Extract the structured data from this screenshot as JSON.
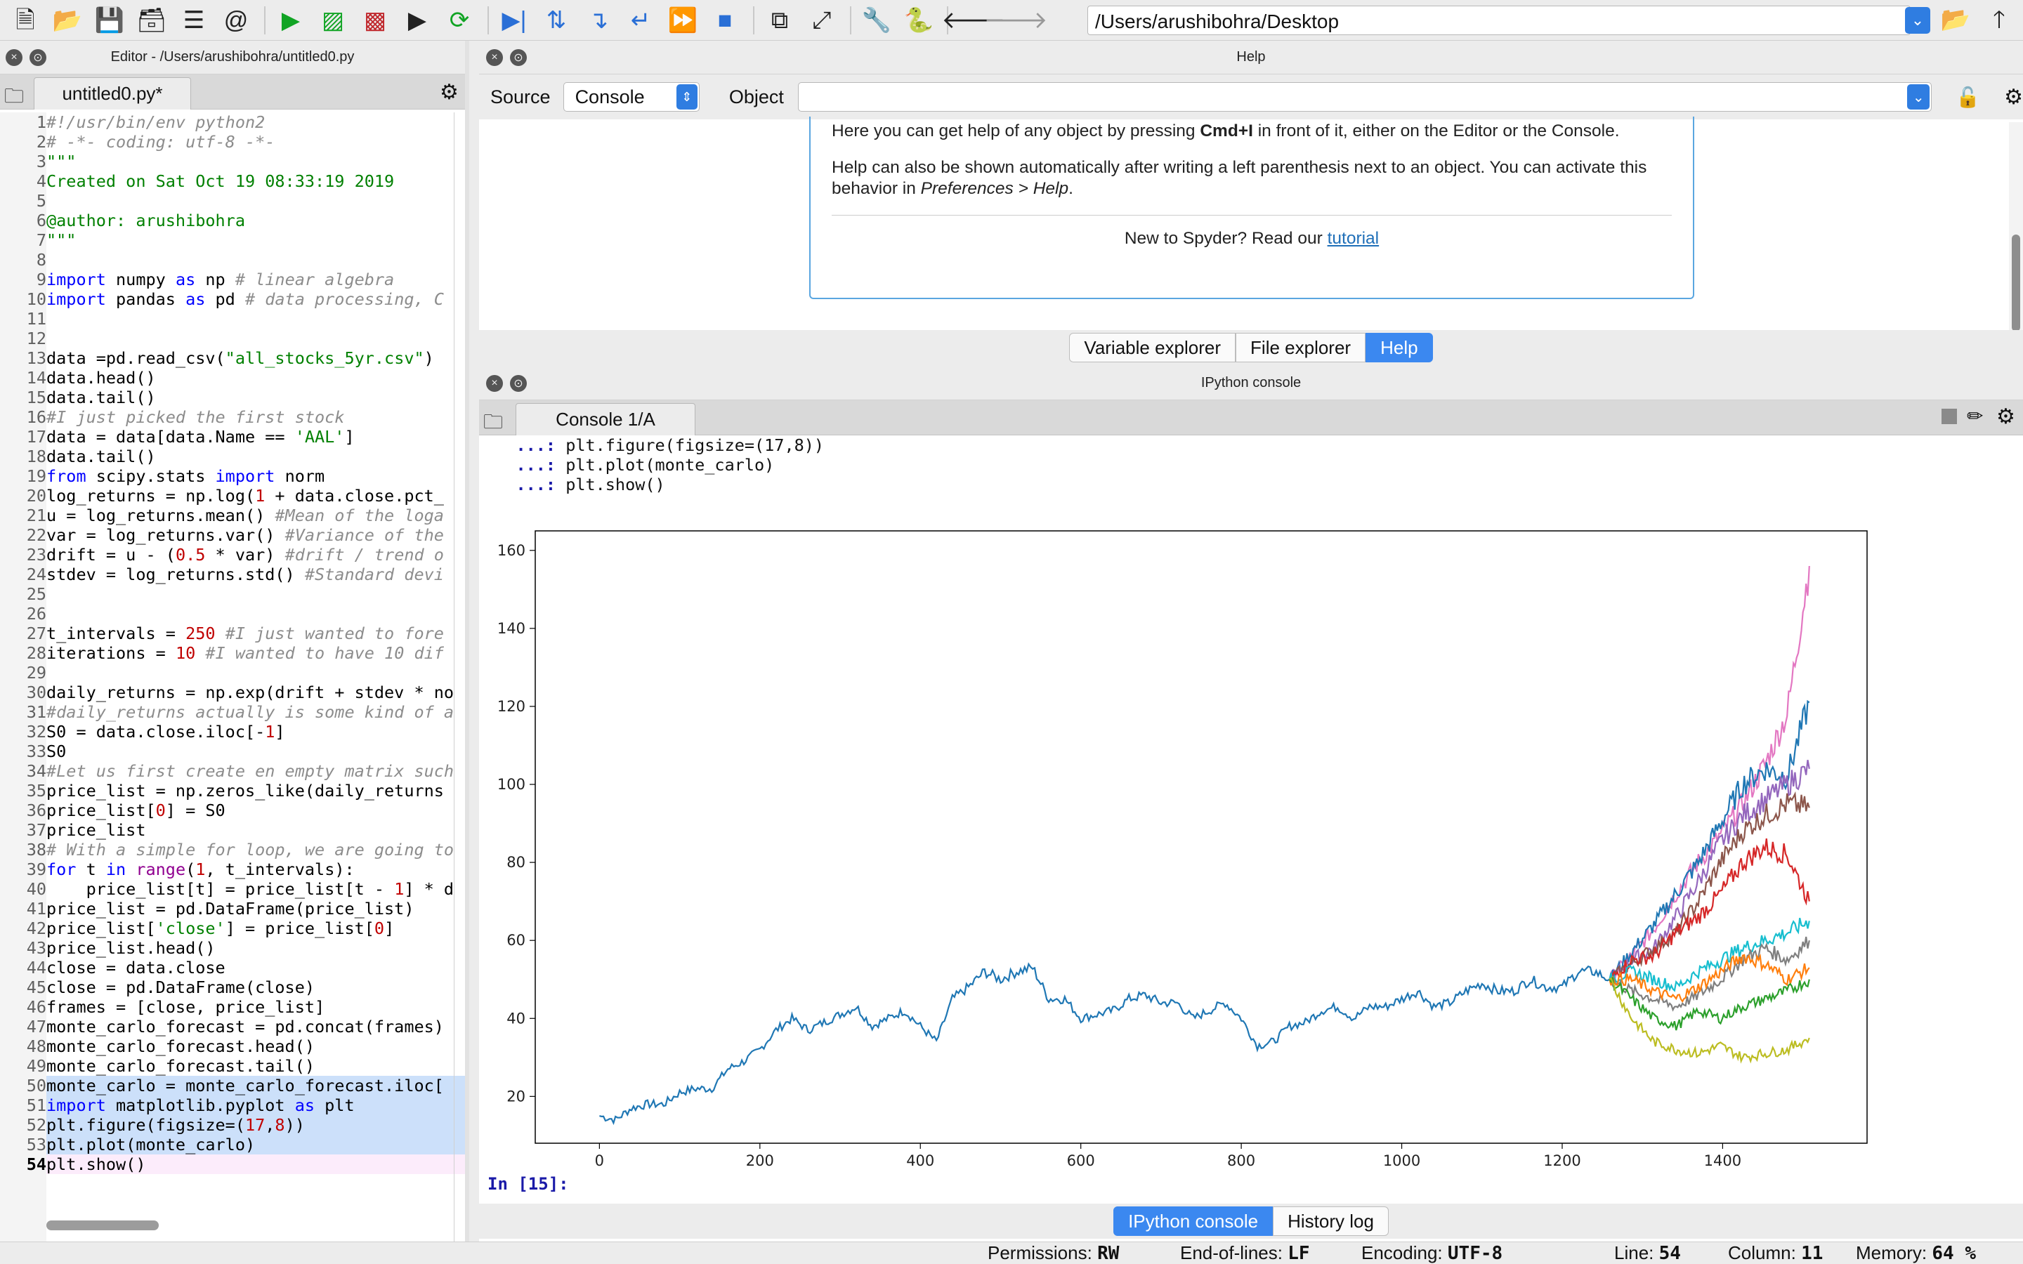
{
  "toolbar": {
    "icons": [
      "new-file-icon",
      "open-folder-icon",
      "save-icon",
      "save-all-icon",
      "outline-icon",
      "at-icon",
      "run-icon",
      "run-cell-icon",
      "run-cell-advance-icon",
      "run-selection-icon",
      "rerun-icon",
      "debug-icon",
      "step-icon",
      "step-into-icon",
      "step-return-icon",
      "continue-icon",
      "stop-icon",
      "maximize-pane-icon",
      "fullscreen-icon",
      "preferences-icon",
      "python-path-icon",
      "back-icon",
      "forward-icon"
    ],
    "working_dir": "/Users/arushibohra/Desktop"
  },
  "editor": {
    "title": "Editor - /Users/arushibohra/untitled0.py",
    "tab_label": "untitled0.py*",
    "lines": [
      {
        "n": "1",
        "html": "<span class='c'>#!/usr/bin/env python2</span>"
      },
      {
        "n": "2",
        "html": "<span class='c'># -*- coding: utf-8 -*-</span>"
      },
      {
        "n": "3",
        "html": "<span class='d'>\"\"\"</span>"
      },
      {
        "n": "4",
        "html": "<span class='d'>Created on Sat Oct 19 08:33:19 2019</span>"
      },
      {
        "n": "5",
        "html": ""
      },
      {
        "n": "6",
        "html": "<span class='d'>@author: arushibohra</span>"
      },
      {
        "n": "7",
        "html": "<span class='d'>\"\"\"</span>"
      },
      {
        "n": "8",
        "html": ""
      },
      {
        "n": "9",
        "html": "<span class='k'>import</span> numpy <span class='k'>as</span> np <span class='c'># linear algebra</span>"
      },
      {
        "n": "10",
        "html": "<span class='k'>import</span> pandas <span class='k'>as</span> pd <span class='c'># data processing, C</span>"
      },
      {
        "n": "11",
        "html": ""
      },
      {
        "n": "12",
        "html": ""
      },
      {
        "n": "13",
        "html": "data =pd.read_csv(<span class='s'>\"all_stocks_5yr.csv\"</span>)"
      },
      {
        "n": "14",
        "html": "data.head()"
      },
      {
        "n": "15",
        "html": "data.tail()"
      },
      {
        "n": "16",
        "html": "<span class='c'>#I just picked the first stock</span>"
      },
      {
        "n": "17",
        "html": "data = data[data.Name == <span class='s'>'AAL'</span>]"
      },
      {
        "n": "18",
        "html": "data.tail()"
      },
      {
        "n": "19",
        "html": "<span class='k'>from</span> scipy.stats <span class='k'>import</span> norm"
      },
      {
        "n": "20",
        "html": "log_returns = np.log(<span class='n'>1</span> + data.close.pct_"
      },
      {
        "n": "21",
        "html": "u = log_returns.mean() <span class='c'>#Mean of the loga</span>"
      },
      {
        "n": "22",
        "html": "var = log_returns.var() <span class='c'>#Variance of the</span>"
      },
      {
        "n": "23",
        "html": "drift = u - (<span class='n'>0.5</span> * var) <span class='c'>#drift / trend o</span>"
      },
      {
        "n": "24",
        "html": "stdev = log_returns.std() <span class='c'>#Standard devi</span>"
      },
      {
        "n": "25",
        "html": ""
      },
      {
        "n": "26",
        "html": ""
      },
      {
        "n": "27",
        "html": "t_intervals = <span class='n'>250</span> <span class='c'>#I just wanted to fore</span>"
      },
      {
        "n": "28",
        "html": "iterations = <span class='n'>10</span> <span class='c'>#I wanted to have 10 dif</span>"
      },
      {
        "n": "29",
        "html": ""
      },
      {
        "n": "30",
        "html": "daily_returns = np.exp(drift + stdev * no"
      },
      {
        "n": "31",
        "html": "<span class='c'>#daily_returns actually is some kind of a</span>"
      },
      {
        "n": "32",
        "html": "S0 = data.close.iloc[-<span class='n'>1</span>]"
      },
      {
        "n": "33",
        "html": "S0"
      },
      {
        "n": "34",
        "html": "<span class='c'>#Let us first create en empty matrix such</span>"
      },
      {
        "n": "35",
        "html": "price_list = np.zeros_like(daily_returns"
      },
      {
        "n": "36",
        "html": "price_list[<span class='n'>0</span>] = S0"
      },
      {
        "n": "37",
        "html": "price_list"
      },
      {
        "n": "38",
        "html": "<span class='c'># With a simple for loop, we are going to</span>"
      },
      {
        "n": "39",
        "html": "<span class='k'>for</span> t <span class='k'>in</span> <span class='b'>range</span>(<span class='n'>1</span>, t_intervals):"
      },
      {
        "n": "40",
        "html": "    price_list[t] = price_list[t - <span class='n'>1</span>] * d"
      },
      {
        "n": "41",
        "html": "price_list = pd.DataFrame(price_list)"
      },
      {
        "n": "42",
        "html": "price_list[<span class='s'>'close'</span>] = price_list[<span class='n'>0</span>]"
      },
      {
        "n": "43",
        "html": "price_list.head()"
      },
      {
        "n": "44",
        "html": "close = data.close"
      },
      {
        "n": "45",
        "html": "close = pd.DataFrame(close)"
      },
      {
        "n": "46",
        "html": "frames = [close, price_list]"
      },
      {
        "n": "47",
        "html": "monte_carlo_forecast = pd.concat(frames)"
      },
      {
        "n": "48",
        "html": "monte_carlo_forecast.head()"
      },
      {
        "n": "49",
        "html": "monte_carlo_forecast.tail()"
      },
      {
        "n": "50",
        "html": "monte_carlo = monte_carlo_forecast.iloc[",
        "sel": true
      },
      {
        "n": "51",
        "html": "<span class='k'>import</span> matplotlib.pyplot <span class='k'>as</span> plt",
        "sel": true
      },
      {
        "n": "52",
        "html": "plt.figure(figsize=(<span class='n'>17</span>,<span class='n'>8</span>))",
        "sel": true
      },
      {
        "n": "53",
        "html": "plt.plot(monte_carlo)",
        "sel": true
      },
      {
        "n": "54",
        "html": "plt.show()",
        "cur": true
      }
    ]
  },
  "help": {
    "title": "Help",
    "source_label": "Source",
    "source_value": "Console",
    "object_label": "Object",
    "object_value": "",
    "para1_a": "Here you can get help of any object by pressing ",
    "para1_key": "Cmd+I",
    "para1_b": " in front of it, either on the Editor or the Console.",
    "para2_a": "Help can also be shown automatically after writing a left parenthesis next to an object. You can activate this behavior in ",
    "para2_pref": "Preferences > Help",
    "para2_b": ".",
    "new_text": "New to Spyder? Read our ",
    "tutorial_link": "tutorial",
    "tabs": [
      "Variable explorer",
      "File explorer",
      "Help"
    ],
    "active_tab": 2
  },
  "console": {
    "title": "IPython console",
    "tab_label": "Console 1/A",
    "lines": [
      {
        "prompt": "   ...:",
        "code": " plt.figure(figsize=(17,8))"
      },
      {
        "prompt": "   ...:",
        "code": " plt.plot(monte_carlo)"
      },
      {
        "prompt": "   ...:",
        "code": " plt.show()"
      }
    ],
    "input_prompt": "In [15]:",
    "tabs": [
      "IPython console",
      "History log"
    ],
    "active_tab": 0
  },
  "status": {
    "permissions_label": "Permissions:",
    "permissions": "RW",
    "eol_label": "End-of-lines:",
    "eol": "LF",
    "encoding_label": "Encoding:",
    "encoding": "UTF-8",
    "line_label": "Line:",
    "line": "54",
    "column_label": "Column:",
    "column": "11",
    "memory_label": "Memory:",
    "memory": "64 %"
  },
  "chart_data": {
    "type": "line",
    "xlim": [
      -80,
      1580
    ],
    "ylim": [
      8,
      165
    ],
    "xticks": [
      0,
      200,
      400,
      600,
      800,
      1000,
      1200,
      1400
    ],
    "yticks": [
      20,
      40,
      60,
      80,
      100,
      120,
      140,
      160
    ],
    "historical": {
      "color": "#1f77b4",
      "points": [
        [
          0,
          15
        ],
        [
          20,
          14
        ],
        [
          40,
          17
        ],
        [
          60,
          18
        ],
        [
          80,
          18
        ],
        [
          100,
          21
        ],
        [
          120,
          22
        ],
        [
          140,
          22
        ],
        [
          160,
          27
        ],
        [
          180,
          29
        ],
        [
          200,
          32
        ],
        [
          220,
          37
        ],
        [
          240,
          40
        ],
        [
          260,
          37
        ],
        [
          280,
          39
        ],
        [
          300,
          41
        ],
        [
          320,
          43
        ],
        [
          340,
          38
        ],
        [
          360,
          40
        ],
        [
          380,
          42
        ],
        [
          400,
          38
        ],
        [
          420,
          34
        ],
        [
          440,
          45
        ],
        [
          460,
          48
        ],
        [
          480,
          52
        ],
        [
          500,
          50
        ],
        [
          520,
          52
        ],
        [
          540,
          53
        ],
        [
          560,
          45
        ],
        [
          580,
          45
        ],
        [
          600,
          40
        ],
        [
          620,
          41
        ],
        [
          640,
          42
        ],
        [
          660,
          45
        ],
        [
          680,
          46
        ],
        [
          700,
          44
        ],
        [
          720,
          44
        ],
        [
          740,
          40
        ],
        [
          760,
          42
        ],
        [
          780,
          44
        ],
        [
          800,
          40
        ],
        [
          820,
          33
        ],
        [
          840,
          34
        ],
        [
          860,
          38
        ],
        [
          880,
          39
        ],
        [
          900,
          42
        ],
        [
          920,
          43
        ],
        [
          940,
          40
        ],
        [
          960,
          43
        ],
        [
          980,
          43
        ],
        [
          1000,
          45
        ],
        [
          1020,
          47
        ],
        [
          1040,
          43
        ],
        [
          1060,
          44
        ],
        [
          1080,
          47
        ],
        [
          1100,
          49
        ],
        [
          1120,
          47
        ],
        [
          1140,
          47
        ],
        [
          1160,
          50
        ],
        [
          1180,
          48
        ],
        [
          1200,
          48
        ],
        [
          1220,
          52
        ],
        [
          1240,
          52
        ],
        [
          1259,
          50
        ]
      ]
    },
    "forecast": {
      "x_start": 1259,
      "x_end": 1508,
      "series": [
        {
          "color": "#e377c2",
          "values": [
            50,
            56,
            63,
            72,
            80,
            87,
            95,
            105,
            118,
            156
          ]
        },
        {
          "color": "#1f77b4",
          "values": [
            50,
            57,
            64,
            72,
            80,
            90,
            100,
            104,
            102,
            121
          ]
        },
        {
          "color": "#9467bd",
          "values": [
            50,
            55,
            58,
            66,
            75,
            85,
            92,
            96,
            100,
            104
          ]
        },
        {
          "color": "#8c564b",
          "values": [
            50,
            54,
            58,
            62,
            70,
            80,
            88,
            92,
            95,
            94
          ]
        },
        {
          "color": "#d62728",
          "values": [
            50,
            55,
            56,
            62,
            66,
            72,
            80,
            84,
            82,
            70
          ]
        },
        {
          "color": "#17becf",
          "values": [
            50,
            52,
            50,
            48,
            52,
            55,
            58,
            60,
            62,
            65
          ]
        },
        {
          "color": "#7f7f7f",
          "values": [
            50,
            47,
            45,
            43,
            46,
            50,
            55,
            58,
            55,
            60
          ]
        },
        {
          "color": "#ff7f0e",
          "values": [
            50,
            50,
            47,
            45,
            48,
            52,
            56,
            54,
            50,
            53
          ]
        },
        {
          "color": "#2ca02c",
          "values": [
            50,
            45,
            40,
            38,
            42,
            40,
            43,
            45,
            47,
            50
          ]
        },
        {
          "color": "#bcbd22",
          "values": [
            50,
            40,
            34,
            32,
            31,
            33,
            30,
            31,
            32,
            35
          ]
        }
      ]
    }
  }
}
